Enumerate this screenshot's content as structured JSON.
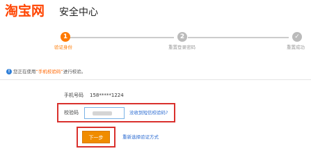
{
  "header": {
    "logo": "淘宝网",
    "title": "安全中心"
  },
  "steps": [
    {
      "number": "1",
      "label": "验证身份",
      "state": "active"
    },
    {
      "number": "2",
      "label": "重置登录密码",
      "state": "pending"
    },
    {
      "number": "✓",
      "label": "重置成功",
      "state": "pending"
    }
  ],
  "notice": {
    "prefix": "您正在使用",
    "method": "“手机校验码”",
    "suffix": "进行校验。"
  },
  "form": {
    "phone_label": "手机号码",
    "phone_value": "158*****1224",
    "code_label": "校验码",
    "code_link": "没收到短信校验码?",
    "next_button": "下一步",
    "alt_link": "重新选择验证方式"
  },
  "colors": {
    "brand": "#ff4400",
    "active_step": "#ff7a00",
    "highlight_border": "#d9302c",
    "button": "#f08c00",
    "link": "#2b6bd1"
  }
}
